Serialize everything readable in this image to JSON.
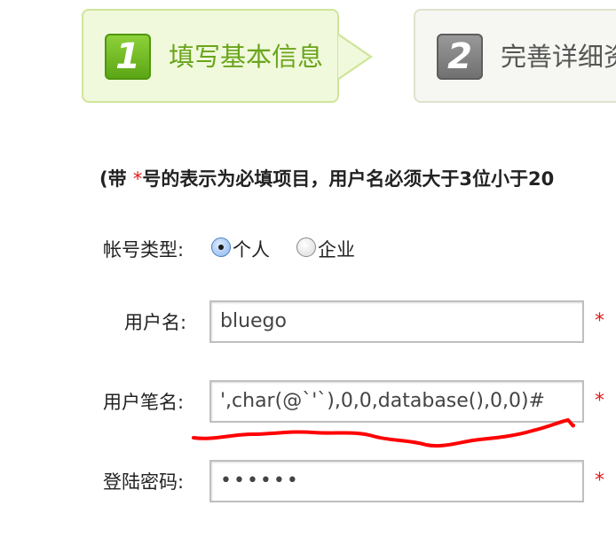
{
  "steps": [
    {
      "number": "1",
      "label": "填写基本信息",
      "active": true
    },
    {
      "number": "2",
      "label": "完善详细资",
      "active": false
    }
  ],
  "note": {
    "prefix": "(带 ",
    "star": "*",
    "text": "号的表示为必填项目，用户名必须大于3位小于20"
  },
  "form": {
    "account_type": {
      "label": "帐号类型:",
      "options": [
        "个人",
        "企业"
      ],
      "selected": "个人"
    },
    "username": {
      "label": "用户名:",
      "value": "bluego",
      "required": "*"
    },
    "nickname": {
      "label": "用户笔名:",
      "value": "',char(@`'`),0,0,database(),0,0)#",
      "required": "*"
    },
    "password": {
      "label": "登陆密码:",
      "value": "••••••",
      "required": "*"
    }
  },
  "colors": {
    "accent_green": "#6aa51c",
    "required_red": "#e11b1b",
    "annotation_red": "#ff0000"
  }
}
